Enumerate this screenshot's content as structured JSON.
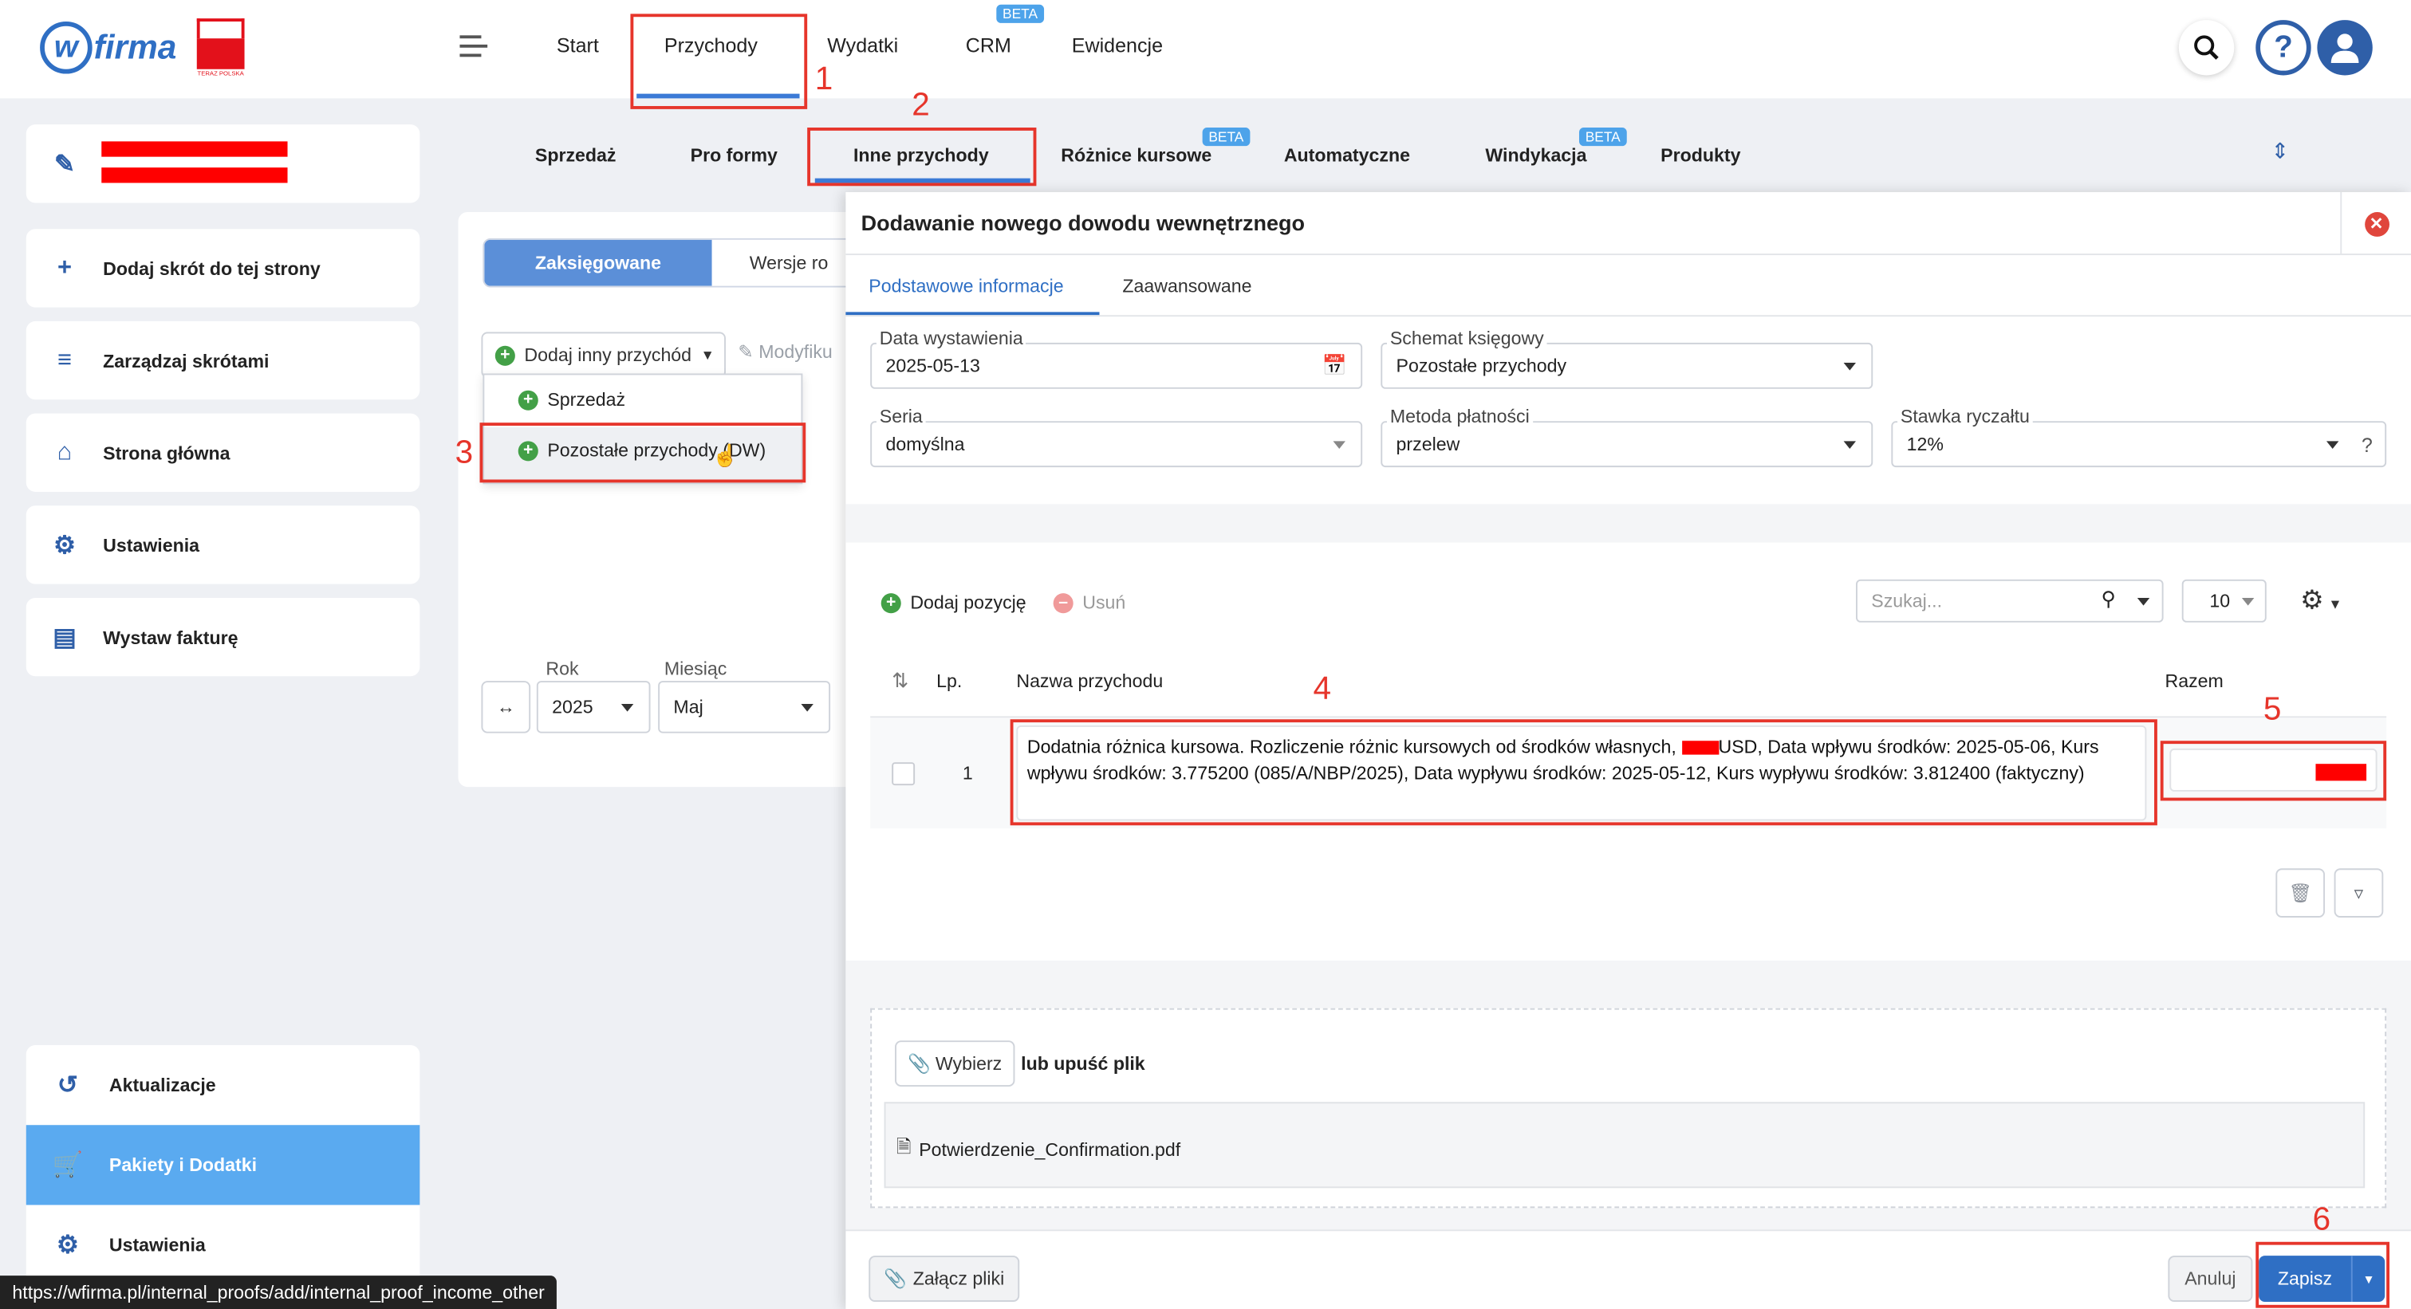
{
  "app": {
    "logo_text": "firma",
    "logo_letter": "w",
    "flag_text": "TERAZ POLSKA"
  },
  "nav": {
    "items": [
      "Start",
      "Przychody",
      "Wydatki",
      "CRM",
      "Ewidencje"
    ],
    "crm_badge": "BETA"
  },
  "subnav": {
    "items": [
      "Sprzedaż",
      "Pro formy",
      "Inne przychody",
      "Różnice kursowe",
      "Automatyczne",
      "Windykacja",
      "Produkty"
    ],
    "badge": "BETA"
  },
  "annotations": {
    "n1": "1",
    "n2": "2",
    "n3": "3",
    "n4": "4",
    "n5": "5",
    "n6": "6"
  },
  "sidebar": {
    "shortcuts": [
      "Dodaj skrót do tej strony",
      "Zarządzaj skrótami",
      "Strona główna",
      "Ustawienia",
      "Wystaw fakturę"
    ],
    "bottom": [
      "Aktualizacje",
      "Pakiety i Dodatki",
      "Ustawienia"
    ]
  },
  "main": {
    "seg_active": "Zaksięgowane",
    "seg_other": "Wersje ro",
    "add_other": "Dodaj inny przychód",
    "modify": "Modyfiku",
    "dropdown": [
      "Sprzedaż",
      "Pozostałe przychody (DW)"
    ],
    "rok_label": "Rok",
    "rok_value": "2025",
    "miesiac_label": "Miesiąc",
    "miesiac_value": "Maj"
  },
  "modal": {
    "title": "Dodawanie nowego dowodu wewnętrznego",
    "tabs": [
      "Podstawowe informacje",
      "Zaawansowane"
    ],
    "date_label": "Data wystawienia",
    "date_value": "2025-05-13",
    "schema_label": "Schemat księgowy",
    "schema_value": "Pozostałe przychody",
    "series_label": "Seria",
    "series_value": "domyślna",
    "payment_label": "Metoda płatności",
    "payment_value": "przelew",
    "rate_label": "Stawka ryczałtu",
    "rate_value": "12%",
    "help": "?",
    "add_position": "Dodaj pozycję",
    "remove": "Usuń",
    "search_placeholder": "Szukaj...",
    "page_size": "10",
    "table_headers": {
      "lp": "Lp.",
      "name": "Nazwa przychodu",
      "total": "Razem"
    },
    "row": {
      "lp": "1",
      "text_a": "Dodatnia różnica kursowa. Rozliczenie różnic kursowych od środków własnych, ",
      "text_b": "USD, Data wpływu środków: 2025-05-06, Kurs wpływu środków: 3.775200 (085/A/NBP/2025), Data wypływu środków: 2025-05-12, Kurs wypływu środków: 3.812400 (faktyczny)"
    },
    "choose": "Wybierz",
    "drop_text": "lub upuść plik",
    "file_name": "Potwierdzenie_Confirmation.pdf",
    "attach": "Załącz pliki",
    "cancel": "Anuluj",
    "save": "Zapisz"
  },
  "status_url": "https://wfirma.pl/internal_proofs/add/internal_proof_income_other",
  "colors": {
    "accent": "#3b7ad6",
    "annotation": "#e6352b",
    "redact": "#ff0000",
    "active_side": "#5aaaf0"
  }
}
